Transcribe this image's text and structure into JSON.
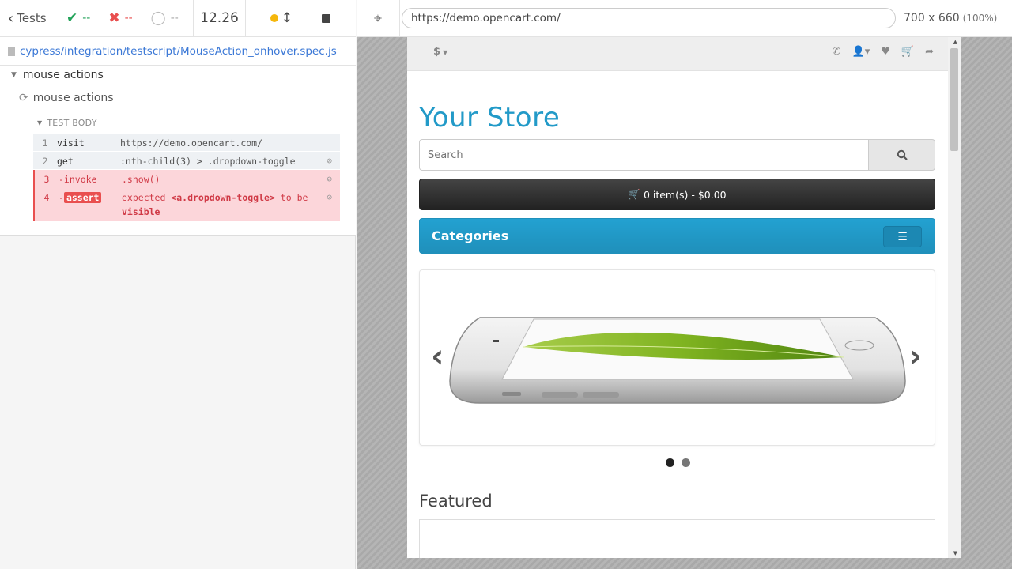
{
  "reporter": {
    "tests_label": "Tests",
    "stats": {
      "passed": "--",
      "failed": "--",
      "pending": "--"
    },
    "duration": "12.26",
    "spec_path": "cypress/integration/testscript/MouseAction_onhover.spec.js",
    "suite_title": "mouse actions",
    "test_title": "mouse actions",
    "test_body_label": "TEST BODY",
    "commands": [
      {
        "num": "1",
        "name": "visit",
        "message": "https://demo.opencart.com/"
      },
      {
        "num": "2",
        "name": "get",
        "message": ":nth-child(3) > .dropdown-toggle"
      },
      {
        "num": "3",
        "name": "-invoke",
        "message": ".show()"
      },
      {
        "num": "4",
        "name_prefix": "-",
        "name": "assert",
        "message_pre": "expected ",
        "message_code": "<a.dropdown-toggle>",
        "message_mid": " to be ",
        "message_bold": "visible"
      }
    ]
  },
  "aut": {
    "url": "https://demo.opencart.com/",
    "viewport": "700 x 660",
    "scale": "(100%)"
  },
  "store": {
    "currency": "$",
    "logo": "Your Store",
    "search_placeholder": "Search",
    "cart_label": "0 item(s) - $0.00",
    "categories_label": "Categories",
    "featured_label": "Featured",
    "top_icons": [
      "phone-icon",
      "user-icon",
      "heart-icon",
      "cart-icon",
      "share-icon"
    ]
  },
  "colors": {
    "pass": "#23a35a",
    "fail": "#e94f4f",
    "link": "#3b78d6",
    "store_blue": "#229ac8"
  }
}
